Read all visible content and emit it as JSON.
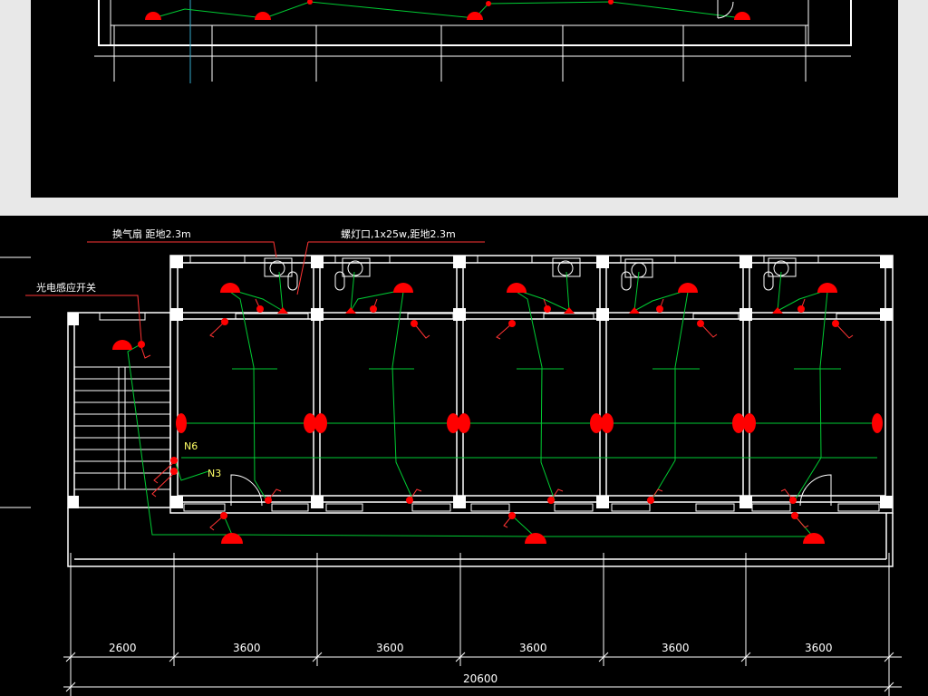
{
  "colors": {
    "background": "#000000",
    "wall": "#ffffff",
    "wiring": "#00cc33",
    "fixture": "#ff0000",
    "leader": "#ff3333",
    "dimension": "#ffffff",
    "node_label": "#ffff66"
  },
  "labels": {
    "exhaust_fan": "换气扇 距地2.3m",
    "lamp_holder": "螺灯口,1x25w,距地2.3m",
    "sensor_switch": "光电感应开关"
  },
  "nodes": {
    "n6": "N6",
    "n3": "N3"
  },
  "dimensions": {
    "segments": [
      "2600",
      "3600",
      "3600",
      "3600",
      "3600",
      "3600"
    ],
    "total": "20600"
  }
}
